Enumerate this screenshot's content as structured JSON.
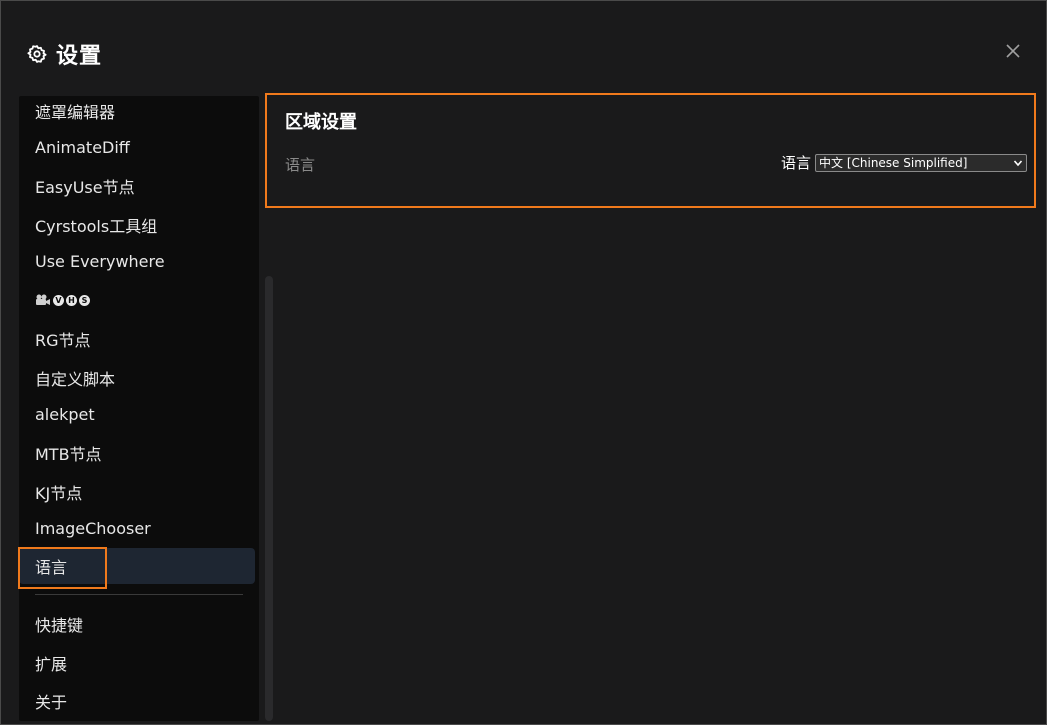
{
  "header": {
    "title": "设置",
    "icon": "gear-icon"
  },
  "sidebar": {
    "items": [
      {
        "label": "遮罩编辑器"
      },
      {
        "label": "AnimateDiff"
      },
      {
        "label": "EasyUse节点"
      },
      {
        "label": "Cyrstools工具组"
      },
      {
        "label": "Use Everywhere"
      },
      {
        "label": "",
        "icons": [
          "camera-icon",
          "V",
          "H",
          "S"
        ]
      },
      {
        "label": "RG节点"
      },
      {
        "label": "自定义脚本"
      },
      {
        "label": "alekpet"
      },
      {
        "label": "MTB节点"
      },
      {
        "label": "KJ节点"
      },
      {
        "label": "ImageChooser"
      },
      {
        "label": "语言",
        "active": true
      }
    ],
    "footer_items": [
      {
        "label": "快捷键"
      },
      {
        "label": "扩展"
      },
      {
        "label": "关于"
      }
    ]
  },
  "vhs": {
    "v": "V",
    "h": "H",
    "s": "S"
  },
  "content": {
    "section_title": "区域设置",
    "setting_label": "语言",
    "control_label": "语言",
    "select_value": "中文 [Chinese Simplified]"
  },
  "colors": {
    "accent": "#f07a1c",
    "background": "#1a1a1b",
    "sidebar": "#0c0c0c",
    "active_item": "#1e2632"
  }
}
